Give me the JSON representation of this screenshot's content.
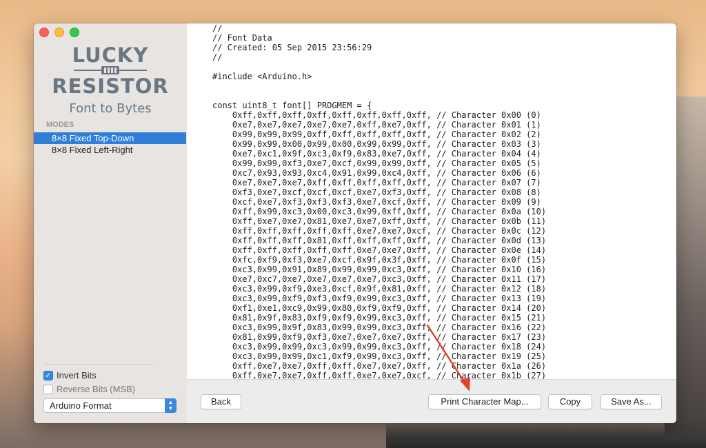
{
  "app": {
    "logo_line1": "LUCKY",
    "logo_line2": "RESISTOR",
    "logo_subtitle": "Font to Bytes"
  },
  "sidebar": {
    "modes_header": "MODES",
    "modes": [
      {
        "label": "8×8 Fixed Top-Down",
        "selected": true
      },
      {
        "label": "8×8 Fixed Left-Right",
        "selected": false
      }
    ],
    "options": {
      "invert_bits": {
        "label": "Invert Bits",
        "checked": true
      },
      "reverse_bits": {
        "label": "Reverse Bits (MSB)",
        "checked": false
      },
      "format": {
        "value": "Arduino Format"
      }
    }
  },
  "code": {
    "header": [
      "//",
      "// Font Data",
      "// Created: 05 Sep 2015 23:56:29",
      "//",
      "",
      "#include <Arduino.h>",
      "",
      "",
      "const uint8_t font[] PROGMEM = {"
    ],
    "rows": [
      {
        "bytes": "0xff,0xff,0xff,0xff,0xff,0xff,0xff,0xff",
        "comment": "Character 0x00 (0)"
      },
      {
        "bytes": "0xe7,0xe7,0xe7,0xe7,0xe7,0xff,0xe7,0xff",
        "comment": "Character 0x01 (1)"
      },
      {
        "bytes": "0x99,0x99,0x99,0xff,0xff,0xff,0xff,0xff",
        "comment": "Character 0x02 (2)"
      },
      {
        "bytes": "0x99,0x99,0x00,0x99,0x00,0x99,0x99,0xff",
        "comment": "Character 0x03 (3)"
      },
      {
        "bytes": "0xe7,0xc1,0x9f,0xc3,0xf9,0x83,0xe7,0xff",
        "comment": "Character 0x04 (4)"
      },
      {
        "bytes": "0x99,0x99,0xf3,0xe7,0xcf,0x99,0x99,0xff",
        "comment": "Character 0x05 (5)"
      },
      {
        "bytes": "0xc7,0x93,0x93,0xc4,0x91,0x99,0xc4,0xff",
        "comment": "Character 0x06 (6)"
      },
      {
        "bytes": "0xe7,0xe7,0xe7,0xff,0xff,0xff,0xff,0xff",
        "comment": "Character 0x07 (7)"
      },
      {
        "bytes": "0xf3,0xe7,0xcf,0xcf,0xcf,0xe7,0xf3,0xff",
        "comment": "Character 0x08 (8)"
      },
      {
        "bytes": "0xcf,0xe7,0xf3,0xf3,0xf3,0xe7,0xcf,0xff",
        "comment": "Character 0x09 (9)"
      },
      {
        "bytes": "0xff,0x99,0xc3,0x00,0xc3,0x99,0xff,0xff",
        "comment": "Character 0x0a (10)"
      },
      {
        "bytes": "0xff,0xe7,0xe7,0x81,0xe7,0xe7,0xff,0xff",
        "comment": "Character 0x0b (11)"
      },
      {
        "bytes": "0xff,0xff,0xff,0xff,0xff,0xe7,0xe7,0xcf",
        "comment": "Character 0x0c (12)"
      },
      {
        "bytes": "0xff,0xff,0xff,0x81,0xff,0xff,0xff,0xff",
        "comment": "Character 0x0d (13)"
      },
      {
        "bytes": "0xff,0xff,0xff,0xff,0xff,0xe7,0xe7,0xff",
        "comment": "Character 0x0e (14)"
      },
      {
        "bytes": "0xfc,0xf9,0xf3,0xe7,0xcf,0x9f,0x3f,0xff",
        "comment": "Character 0x0f (15)"
      },
      {
        "bytes": "0xc3,0x99,0x91,0x89,0x99,0x99,0xc3,0xff",
        "comment": "Character 0x10 (16)"
      },
      {
        "bytes": "0xe7,0xc7,0xe7,0xe7,0xe7,0xe7,0xc3,0xff",
        "comment": "Character 0x11 (17)"
      },
      {
        "bytes": "0xc3,0x99,0xf9,0xe3,0xcf,0x9f,0x81,0xff",
        "comment": "Character 0x12 (18)"
      },
      {
        "bytes": "0xc3,0x99,0xf9,0xf3,0xf9,0x99,0xc3,0xff",
        "comment": "Character 0x13 (19)"
      },
      {
        "bytes": "0xf1,0xe1,0xc9,0x99,0x80,0xf9,0xf9,0xff",
        "comment": "Character 0x14 (20)"
      },
      {
        "bytes": "0x81,0x9f,0x83,0xf9,0xf9,0x99,0xc3,0xff",
        "comment": "Character 0x15 (21)"
      },
      {
        "bytes": "0xc3,0x99,0x9f,0x83,0x99,0x99,0xc3,0xff",
        "comment": "Character 0x16 (22)"
      },
      {
        "bytes": "0x81,0x99,0xf9,0xf3,0xe7,0xe7,0xe7,0xff",
        "comment": "Character 0x17 (23)"
      },
      {
        "bytes": "0xc3,0x99,0x99,0xc3,0x99,0x99,0xc3,0xff",
        "comment": "Character 0x18 (24)"
      },
      {
        "bytes": "0xc3,0x99,0x99,0xc1,0xf9,0x99,0xc3,0xff",
        "comment": "Character 0x19 (25)"
      },
      {
        "bytes": "0xff,0xe7,0xe7,0xff,0xff,0xe7,0xe7,0xff",
        "comment": "Character 0x1a (26)"
      },
      {
        "bytes": "0xff,0xe7,0xe7,0xff,0xff,0xe7,0xe7,0xcf",
        "comment": "Character 0x1b (27)"
      }
    ]
  },
  "buttons": {
    "back": "Back",
    "print_map": "Print Character Map...",
    "copy": "Copy",
    "save_as": "Save As..."
  },
  "annotation_color": "#e0442a"
}
